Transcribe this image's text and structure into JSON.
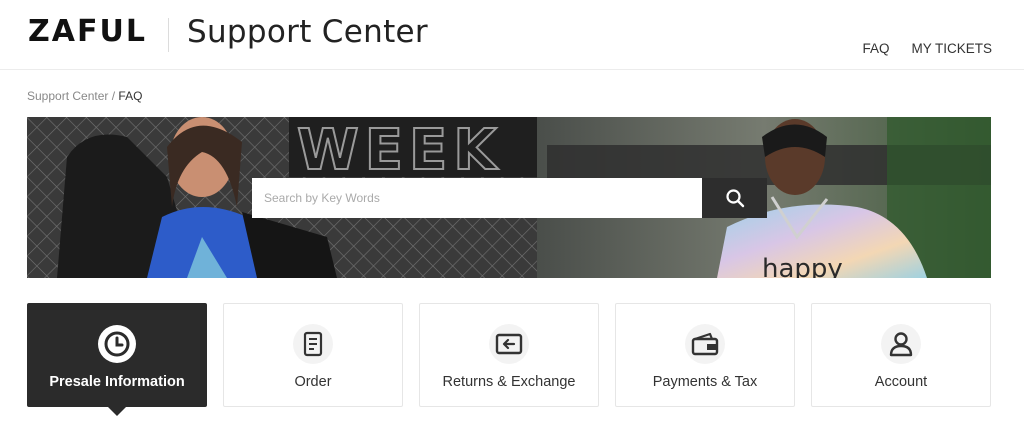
{
  "header": {
    "logo": "ZAFUL",
    "title": "Support Center",
    "nav": [
      {
        "label": "FAQ"
      },
      {
        "label": "MY TICKETS"
      }
    ]
  },
  "breadcrumb": {
    "root": "Support Center",
    "separator": " / ",
    "current": "FAQ"
  },
  "banner": {
    "bg_text": "WEEK"
  },
  "search": {
    "placeholder": "Search by Key Words",
    "value": ""
  },
  "categories": [
    {
      "label": "Presale Information",
      "icon": "clock-icon",
      "active": true
    },
    {
      "label": "Order",
      "icon": "document-icon",
      "active": false
    },
    {
      "label": "Returns & Exchange",
      "icon": "return-box-icon",
      "active": false
    },
    {
      "label": "Payments & Tax",
      "icon": "wallet-icon",
      "active": false
    },
    {
      "label": "Account",
      "icon": "user-icon",
      "active": false
    }
  ],
  "colors": {
    "active_card": "#2b2b2b",
    "text": "#333333",
    "border": "#e6e6e6"
  }
}
